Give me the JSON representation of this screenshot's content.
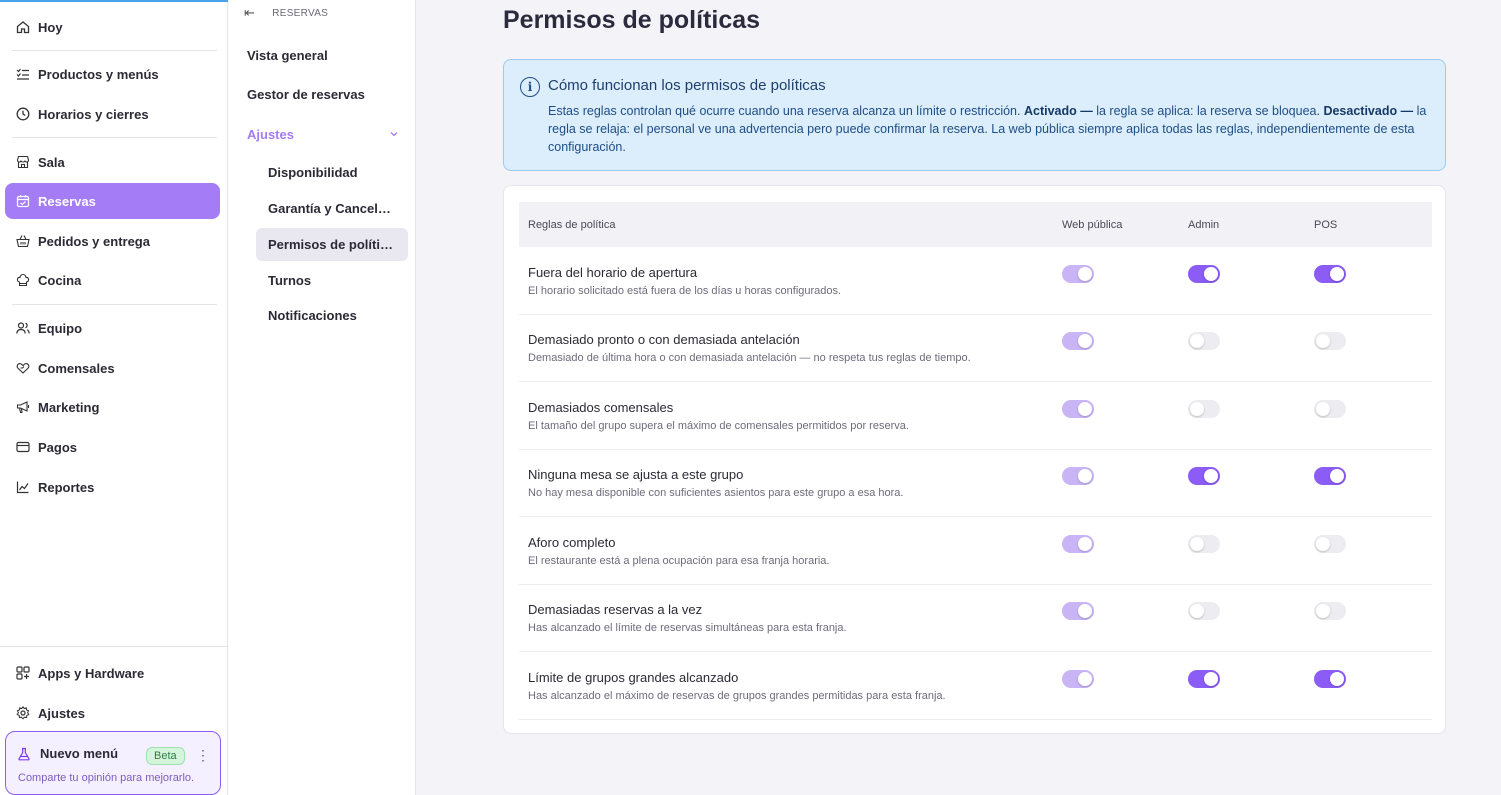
{
  "sidebar": {
    "items": [
      {
        "label": "Hoy",
        "icon": "home-icon"
      },
      {
        "label": "Productos y menús",
        "icon": "list-check-icon"
      },
      {
        "label": "Horarios y cierres",
        "icon": "clock-icon"
      },
      {
        "label": "Sala",
        "icon": "store-icon"
      },
      {
        "label": "Reservas",
        "icon": "calendar-icon",
        "active": true
      },
      {
        "label": "Pedidos y entrega",
        "icon": "basket-icon"
      },
      {
        "label": "Cocina",
        "icon": "chef-hat-icon"
      },
      {
        "label": "Equipo",
        "icon": "users-icon"
      },
      {
        "label": "Comensales",
        "icon": "heart-hand-icon"
      },
      {
        "label": "Marketing",
        "icon": "megaphone-icon"
      },
      {
        "label": "Pagos",
        "icon": "card-icon"
      },
      {
        "label": "Reportes",
        "icon": "chart-icon"
      }
    ],
    "bottom": [
      {
        "label": "Apps y Hardware",
        "icon": "apps-icon"
      },
      {
        "label": "Ajustes",
        "icon": "gear-icon"
      }
    ],
    "beta_card": {
      "title": "Nuevo menú",
      "badge": "Beta",
      "subtitle": "Comparte tu opinión para mejorarlo."
    },
    "accent": "#a37cf6"
  },
  "subnav": {
    "back_label": "RESERVAS",
    "items": [
      "Vista general",
      "Gestor de reservas"
    ],
    "group_label": "Ajustes",
    "children": [
      "Disponibilidad",
      "Garantía y Cancelación",
      "Permisos de políticas",
      "Turnos",
      "Notificaciones"
    ],
    "active_child": "Permisos de políticas"
  },
  "main": {
    "title": "Permisos de políticas",
    "info": {
      "title": "Cómo funcionan los permisos de políticas",
      "text_1": "Estas reglas controlan qué ocurre cuando una reserva alcanza un límite o restricción.",
      "bold_1": "Activado —",
      "text_2": "la regla se aplica: la reserva se bloquea.",
      "bold_2": "Desactivado —",
      "text_3": "la regla se relaja: el personal ve una advertencia pero puede confirmar la reserva. La web pública siempre aplica todas las reglas, independientemente de esta configuración."
    },
    "table": {
      "headers": [
        "Reglas de política",
        "Web pública",
        "Admin",
        "POS"
      ],
      "rows": [
        {
          "title": "Fuera del horario de apertura",
          "desc": "El horario solicitado está fuera de los días u horas configurados.",
          "web": "on-locked",
          "admin": "on",
          "pos": "on"
        },
        {
          "title": "Demasiado pronto o con demasiada antelación",
          "desc": "Demasiado de última hora o con demasiada antelación — no respeta tus reglas de tiempo.",
          "web": "on-locked",
          "admin": "off",
          "pos": "off"
        },
        {
          "title": "Demasiados comensales",
          "desc": "El tamaño del grupo supera el máximo de comensales permitidos por reserva.",
          "web": "on-locked",
          "admin": "off",
          "pos": "off"
        },
        {
          "title": "Ninguna mesa se ajusta a este grupo",
          "desc": "No hay mesa disponible con suficientes asientos para este grupo a esa hora.",
          "web": "on-locked",
          "admin": "on",
          "pos": "on"
        },
        {
          "title": "Aforo completo",
          "desc": "El restaurante está a plena ocupación para esa franja horaria.",
          "web": "on-locked",
          "admin": "off",
          "pos": "off"
        },
        {
          "title": "Demasiadas reservas a la vez",
          "desc": "Has alcanzado el límite de reservas simultáneas para esta franja.",
          "web": "on-locked",
          "admin": "off",
          "pos": "off"
        },
        {
          "title": "Límite de grupos grandes alcanzado",
          "desc": "Has alcanzado el máximo de reservas de grupos grandes permitidas para esta franja.",
          "web": "on-locked",
          "admin": "on",
          "pos": "on"
        }
      ]
    }
  }
}
